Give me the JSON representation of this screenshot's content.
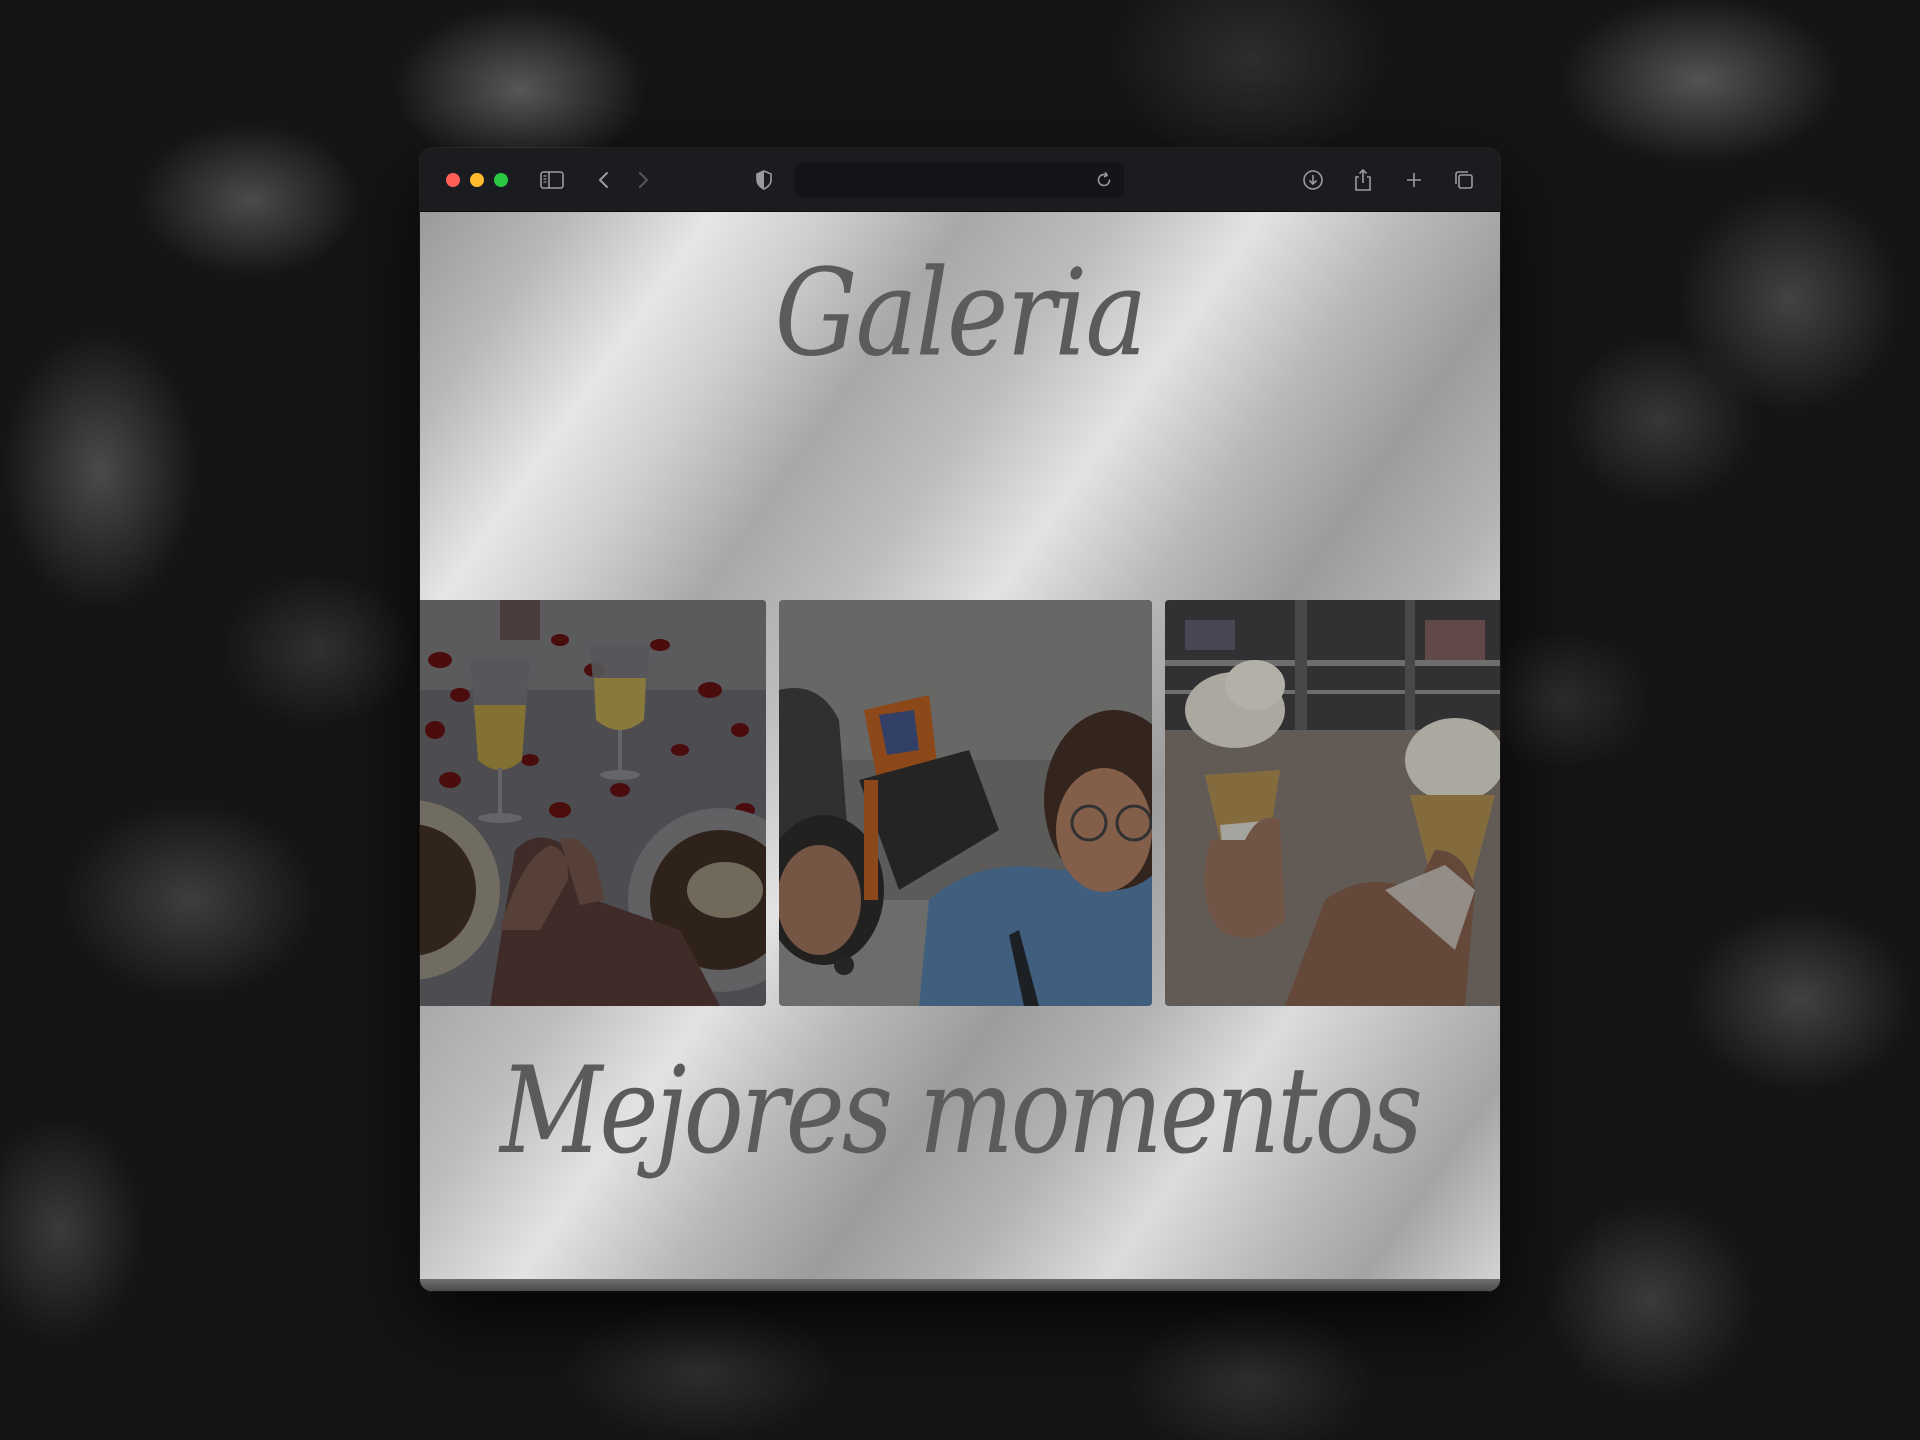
{
  "window": {
    "traffic_lights": [
      "close",
      "minimize",
      "zoom"
    ],
    "address": ""
  },
  "toolbar": {
    "icons": [
      "sidebar-icon",
      "back-icon",
      "forward-icon",
      "privacy-shield-icon",
      "reload-icon",
      "download-icon",
      "share-icon",
      "new-tab-icon",
      "tab-overview-icon"
    ]
  },
  "page": {
    "heading": "Galeria",
    "subheading": "Mejores momentos",
    "photos": [
      {
        "subject": "romantic dinner table with wine glasses and rose petals"
      },
      {
        "subject": "selfie of two people with backpacks"
      },
      {
        "subject": "two hands holding ice cream cones at a mall"
      }
    ]
  },
  "colors": {
    "titlebar": "#1b1c1f",
    "script_text": "#5b5b5b",
    "close": "#ff5f57",
    "minimize": "#febc2e",
    "zoom": "#28c840"
  }
}
